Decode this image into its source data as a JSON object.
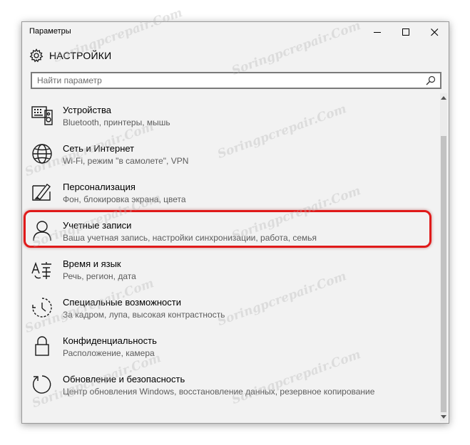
{
  "window": {
    "title": "Параметры",
    "minimize_icon": "minimize-icon",
    "maximize_icon": "maximize-icon",
    "close_icon": "close-icon"
  },
  "header": {
    "icon": "gear-icon",
    "title": "НАСТРОЙКИ"
  },
  "search": {
    "placeholder": "Найти параметр",
    "value": "",
    "icon": "search-icon"
  },
  "items": [
    {
      "icon": "devices-icon",
      "label": "Устройства",
      "desc": "Bluetooth, принтеры, мышь"
    },
    {
      "icon": "globe-icon",
      "label": "Сеть и Интернет",
      "desc": "Wi-Fi, режим \"в самолете\", VPN"
    },
    {
      "icon": "personalization-icon",
      "label": "Персонализация",
      "desc": "Фон, блокировка экрана, цвета"
    },
    {
      "icon": "person-icon",
      "label": "Учетные записи",
      "desc": "Ваша учетная запись, настройки синхронизации, работа, семья"
    },
    {
      "icon": "time-language-icon",
      "label": "Время и язык",
      "desc": "Речь, регион, дата"
    },
    {
      "icon": "ease-of-access-icon",
      "label": "Специальные возможности",
      "desc": "За кадром, лупа, высокая контрастность"
    },
    {
      "icon": "lock-icon",
      "label": "Конфиденциальность",
      "desc": "Расположение, камера"
    },
    {
      "icon": "update-icon",
      "label": "Обновление и безопасность",
      "desc": "Центр обновления Windows, восстановление данных, резервное копирование"
    }
  ],
  "highlight": {
    "color": "#e01a1a",
    "item_index": 1
  },
  "watermark": "Soringpcrepair.Com"
}
